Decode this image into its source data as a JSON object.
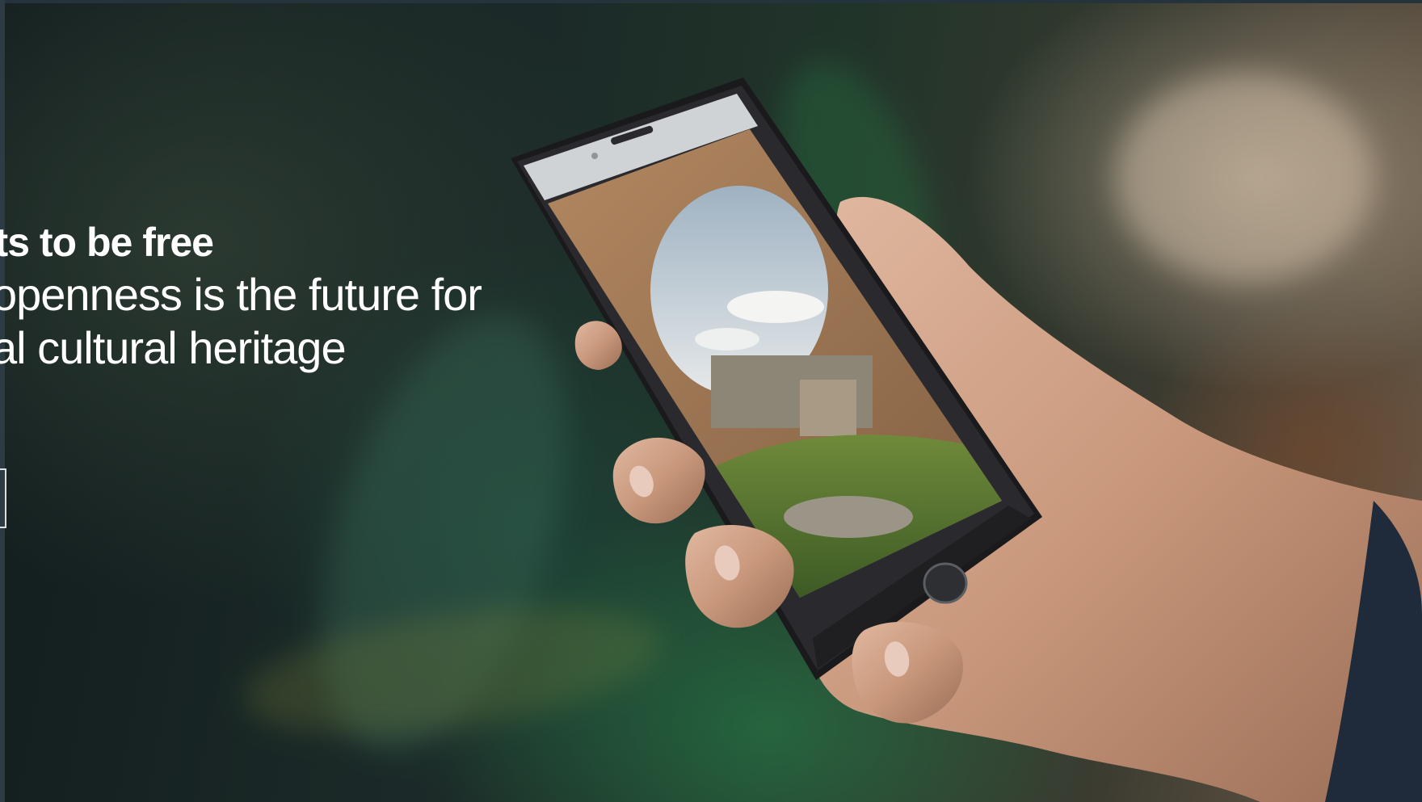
{
  "hero": {
    "headline_bold": "nts to be free",
    "headline_line2": "l openness is the future for",
    "headline_line3": "ital cultural heritage"
  },
  "colors": {
    "text": "#ffffff",
    "background_dark": "#121c1d",
    "foliage_green": "#2b8a55",
    "phone_body": "#1a1a1c"
  },
  "icons": {
    "phone_home_button": "home-button-icon"
  }
}
